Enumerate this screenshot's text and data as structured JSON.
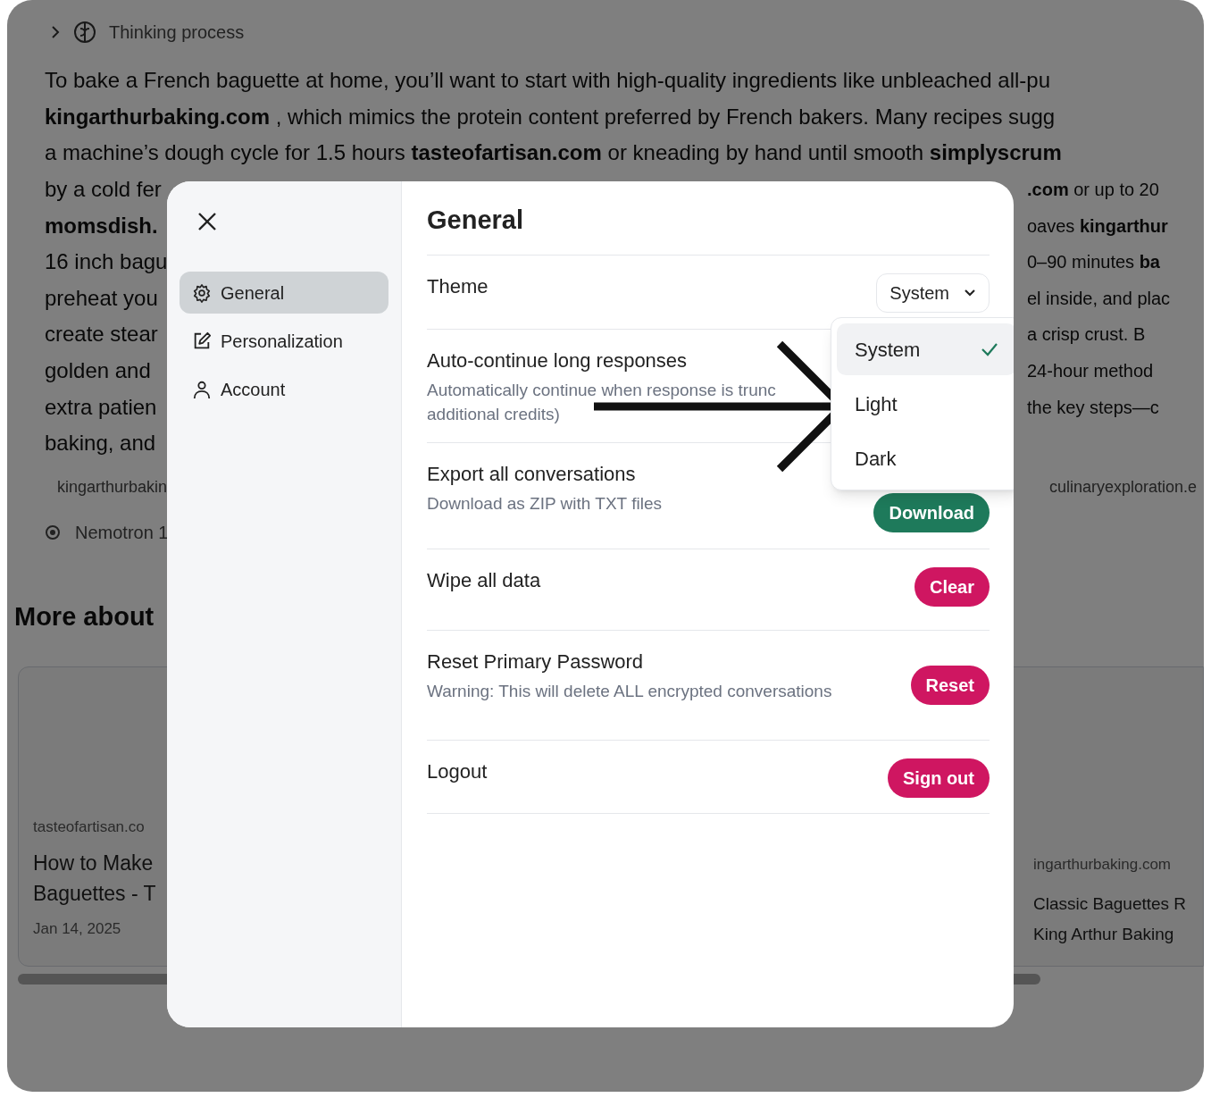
{
  "background": {
    "thinking_label": "Thinking process",
    "lines": [
      {
        "left": "To bake a French baguette at home, you’ll want to start with high-quality ingredients like unbleached all-pu"
      },
      {
        "left": "**kingarthurbaking.com** , which mimics the protein content preferred by French bakers. Many recipes sugg"
      },
      {
        "left": "a machine’s dough cycle for 1.5 hours **tasteofartisan.com** or kneading by hand until smooth **simplyscrum**"
      },
      {
        "left": "by a cold fer",
        "right": "**.com** or up to 20"
      },
      {
        "left": "**momsdish.**",
        "right": "oaves **kingarthur**"
      },
      {
        "left": "16 inch bagu",
        "right": "0–90 minutes **ba**"
      },
      {
        "left": "preheat you",
        "right": "el inside, and plac"
      },
      {
        "left": "create stear",
        "right": "a crisp crust. B"
      },
      {
        "left": "golden and",
        "right": "24-hour method"
      },
      {
        "left": "extra patien",
        "right": "the key steps—c"
      },
      {
        "left": "baking, and"
      }
    ],
    "sources": [
      "kingarthurbakin",
      "culinaryexploration.e"
    ],
    "model": "Nemotron 1",
    "more_heading": "More about",
    "cards": [
      {
        "source": "tasteofartisan.co",
        "title_lines": [
          "How to Make",
          "Baguettes - T"
        ],
        "date": "Jan 14, 2025"
      },
      {
        "source": "ingarthurbaking.com",
        "title_lines": [
          "Classic Baguettes R",
          "King Arthur Baking"
        ]
      }
    ]
  },
  "modal": {
    "nav": [
      {
        "label": "General",
        "selected": true
      },
      {
        "label": "Personalization",
        "selected": false
      },
      {
        "label": "Account",
        "selected": false
      }
    ],
    "title": "General",
    "settings": [
      {
        "label": "Theme",
        "kind": "select",
        "value": "System"
      },
      {
        "label": "Auto-continue long responses",
        "description_lines": [
          "Automatically continue when response is trunc",
          "additional credits)"
        ],
        "kind": "none"
      },
      {
        "label": "Export all conversations",
        "description_lines": [
          "Download as ZIP with TXT files"
        ],
        "kind": "button",
        "button": "Download",
        "color": "#1e7a5b"
      },
      {
        "label": "Wipe all data",
        "kind": "button",
        "button": "Clear",
        "color": "#cf1661"
      },
      {
        "label": "Reset Primary Password",
        "description_lines": [
          "Warning: This will delete ALL encrypted conversations"
        ],
        "kind": "button",
        "button": "Reset",
        "color": "#cf1661"
      },
      {
        "label": "Logout",
        "kind": "button",
        "button": "Sign out",
        "color": "#cf1661"
      }
    ],
    "dropdown": [
      {
        "label": "System",
        "selected": true
      },
      {
        "label": "Light",
        "selected": false
      },
      {
        "label": "Dark",
        "selected": false
      }
    ]
  }
}
